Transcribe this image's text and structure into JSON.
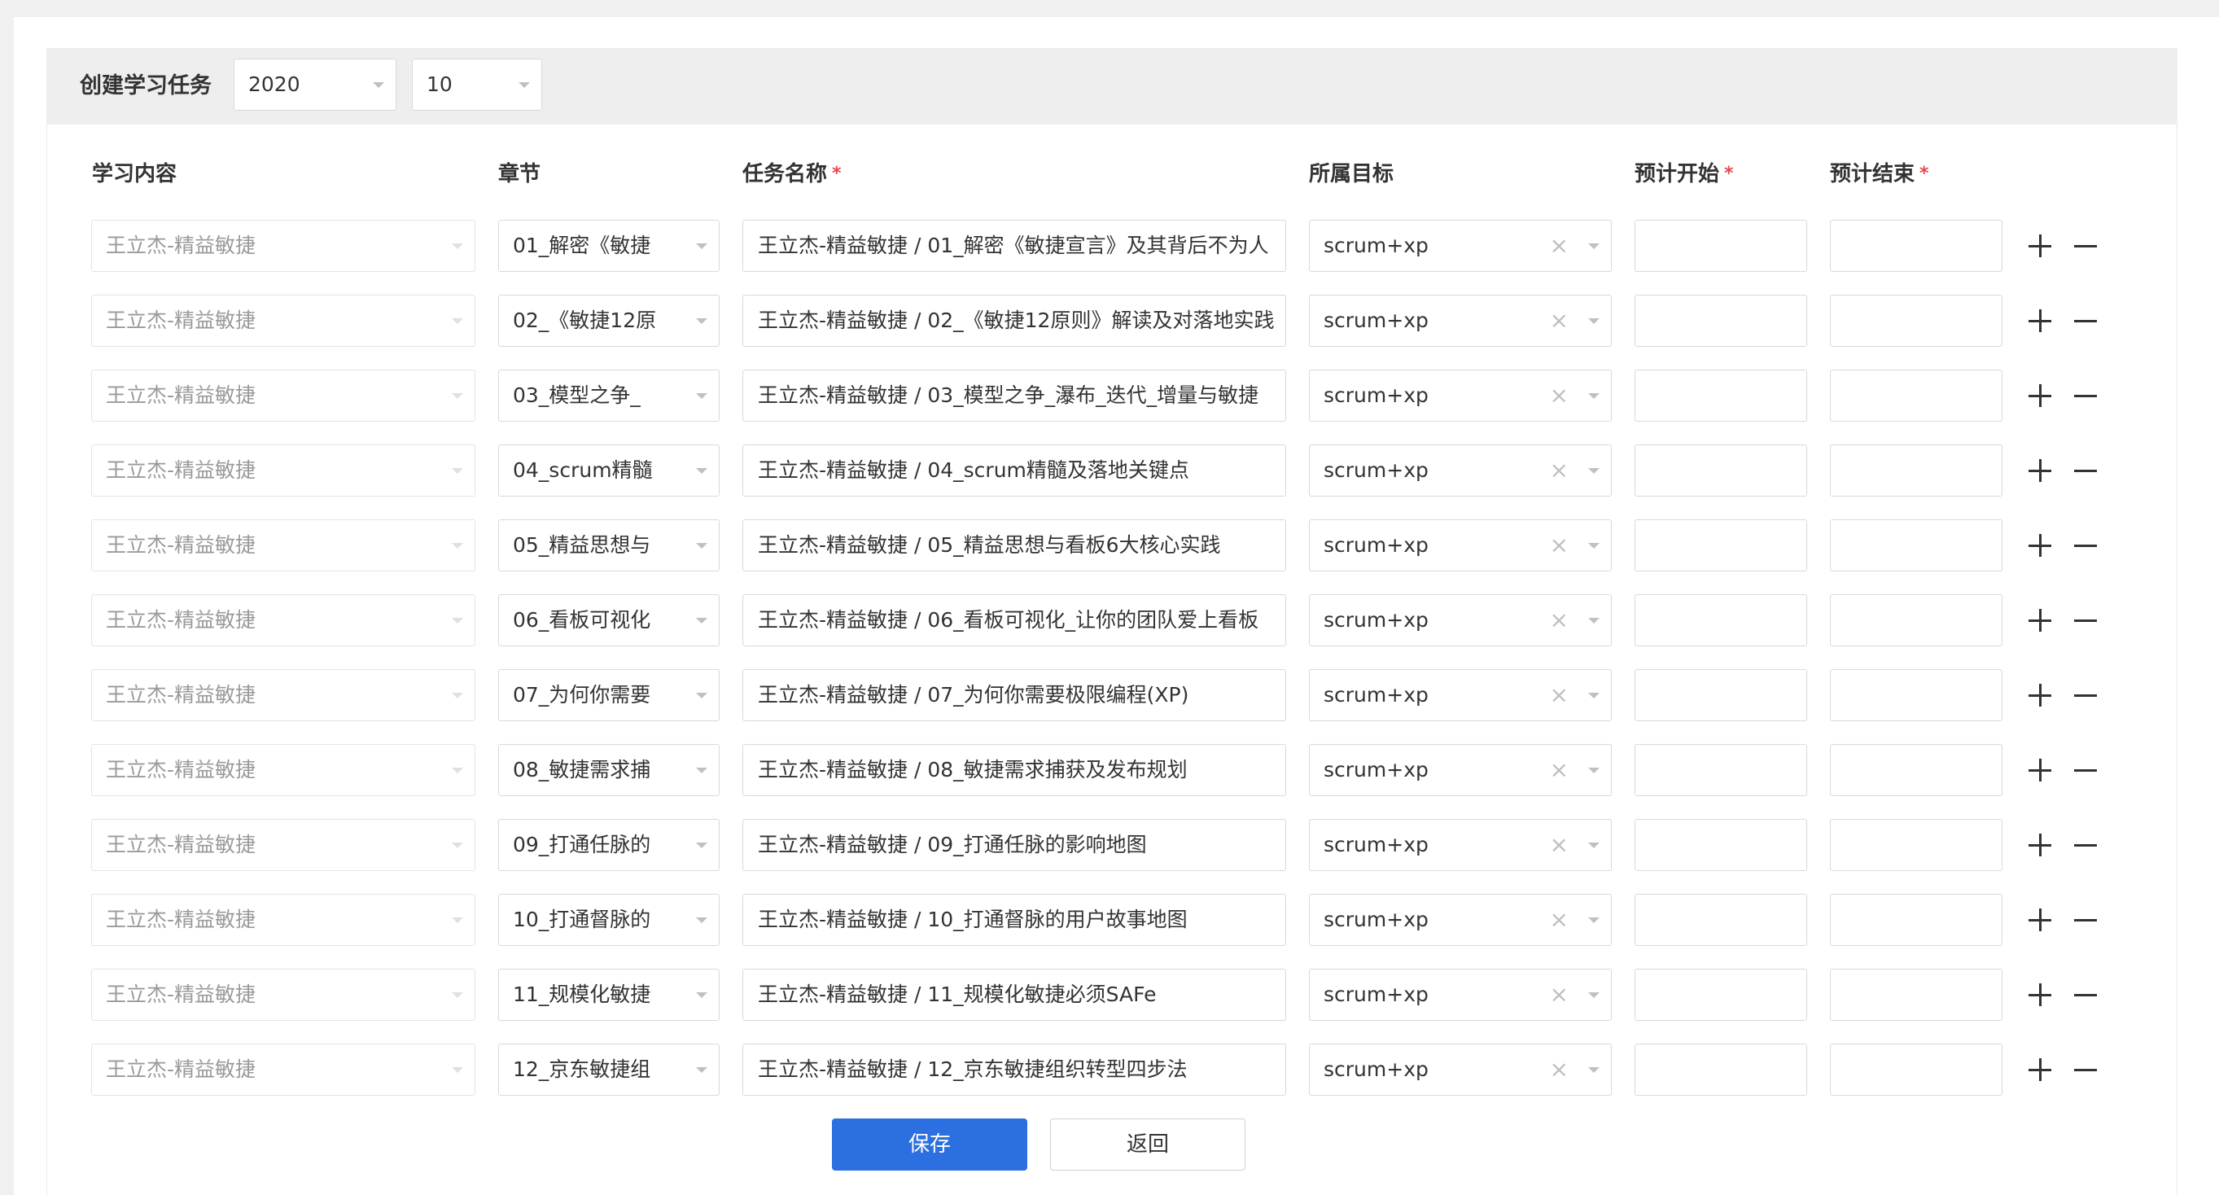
{
  "header": {
    "title": "创建学习任务",
    "year": "2020",
    "month": "10"
  },
  "columns": {
    "content": "学习内容",
    "chapter": "章节",
    "task_name": "任务名称",
    "target": "所属目标",
    "start": "预计开始",
    "end": "预计结束",
    "required_mark": "*"
  },
  "rows": [
    {
      "content": "王立杰-精益敏捷",
      "chapter": "01_解密《敏捷",
      "task_name": "王立杰-精益敏捷 / 01_解密《敏捷宣言》及其背后不为人",
      "target": "scrum+xp",
      "start": "",
      "end": ""
    },
    {
      "content": "王立杰-精益敏捷",
      "chapter": "02_《敏捷12原",
      "task_name": "王立杰-精益敏捷 / 02_《敏捷12原则》解读及对落地实践",
      "target": "scrum+xp",
      "start": "",
      "end": ""
    },
    {
      "content": "王立杰-精益敏捷",
      "chapter": "03_模型之争_",
      "task_name": "王立杰-精益敏捷 / 03_模型之争_瀑布_迭代_增量与敏捷",
      "target": "scrum+xp",
      "start": "",
      "end": ""
    },
    {
      "content": "王立杰-精益敏捷",
      "chapter": "04_scrum精髓",
      "task_name": "王立杰-精益敏捷 / 04_scrum精髓及落地关键点",
      "target": "scrum+xp",
      "start": "",
      "end": ""
    },
    {
      "content": "王立杰-精益敏捷",
      "chapter": "05_精益思想与",
      "task_name": "王立杰-精益敏捷 / 05_精益思想与看板6大核心实践",
      "target": "scrum+xp",
      "start": "",
      "end": ""
    },
    {
      "content": "王立杰-精益敏捷",
      "chapter": "06_看板可视化",
      "task_name": "王立杰-精益敏捷 / 06_看板可视化_让你的团队爱上看板",
      "target": "scrum+xp",
      "start": "",
      "end": ""
    },
    {
      "content": "王立杰-精益敏捷",
      "chapter": "07_为何你需要",
      "task_name": "王立杰-精益敏捷 / 07_为何你需要极限编程(XP)",
      "target": "scrum+xp",
      "start": "",
      "end": ""
    },
    {
      "content": "王立杰-精益敏捷",
      "chapter": "08_敏捷需求捕",
      "task_name": "王立杰-精益敏捷 / 08_敏捷需求捕获及发布规划",
      "target": "scrum+xp",
      "start": "",
      "end": ""
    },
    {
      "content": "王立杰-精益敏捷",
      "chapter": "09_打通任脉的",
      "task_name": "王立杰-精益敏捷 / 09_打通任脉的影响地图",
      "target": "scrum+xp",
      "start": "",
      "end": ""
    },
    {
      "content": "王立杰-精益敏捷",
      "chapter": "10_打通督脉的",
      "task_name": "王立杰-精益敏捷 / 10_打通督脉的用户故事地图",
      "target": "scrum+xp",
      "start": "",
      "end": ""
    },
    {
      "content": "王立杰-精益敏捷",
      "chapter": "11_规模化敏捷",
      "task_name": "王立杰-精益敏捷 / 11_规模化敏捷必须SAFe",
      "target": "scrum+xp",
      "start": "",
      "end": ""
    },
    {
      "content": "王立杰-精益敏捷",
      "chapter": "12_京东敏捷组",
      "task_name": "王立杰-精益敏捷 / 12_京东敏捷组织转型四步法",
      "target": "scrum+xp",
      "start": "",
      "end": ""
    }
  ],
  "footer": {
    "save_label": "保存",
    "back_label": "返回"
  },
  "icons": {
    "add": "plus-icon",
    "remove": "minus-icon",
    "clear": "close-icon",
    "dropdown": "chevron-down-icon"
  },
  "colors": {
    "primary": "#2b6fe0",
    "required": "#e5484d"
  }
}
